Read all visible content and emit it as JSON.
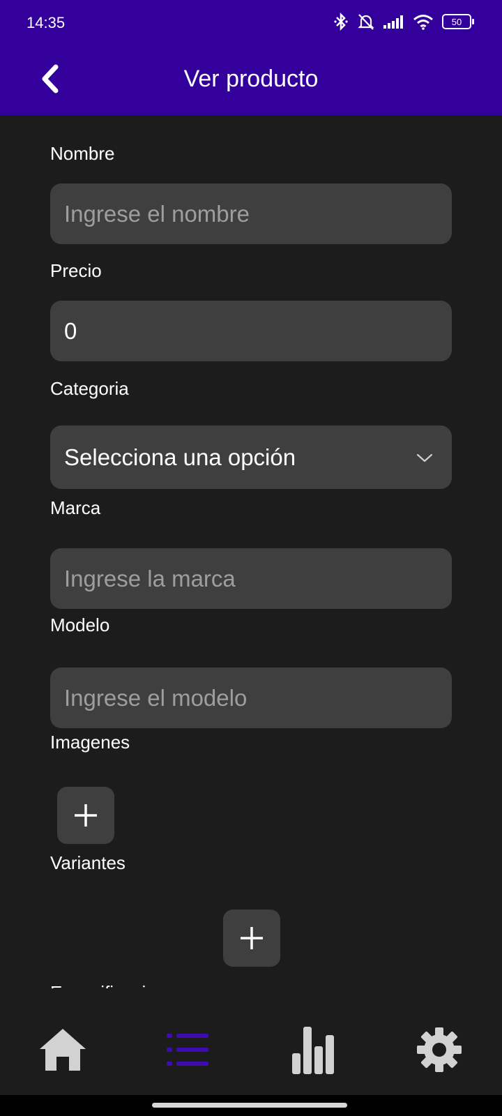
{
  "status_bar": {
    "time": "14:35",
    "battery": "50",
    "icons": [
      "bluetooth-icon",
      "bell-off-icon",
      "signal-icon",
      "wifi-icon",
      "battery-icon"
    ]
  },
  "header": {
    "title": "Ver producto",
    "back_icon": "chevron-left-icon"
  },
  "form": {
    "nombre": {
      "label": "Nombre",
      "placeholder": "Ingrese el nombre",
      "value": ""
    },
    "precio": {
      "label": "Precio",
      "value": "0"
    },
    "categoria": {
      "label": "Categoria",
      "selected": "Selecciona una opción"
    },
    "marca": {
      "label": "Marca",
      "placeholder": "Ingrese la marca",
      "value": ""
    },
    "modelo": {
      "label": "Modelo",
      "placeholder": "Ingrese el modelo",
      "value": ""
    },
    "imagenes": {
      "label": "Imagenes",
      "add_icon": "plus-icon"
    },
    "variantes": {
      "label": "Variantes",
      "add_icon": "plus-icon"
    },
    "especificaciones": {
      "label": "Especificaciones"
    }
  },
  "bottom_nav": {
    "items": [
      {
        "icon": "home-icon",
        "active": false
      },
      {
        "icon": "list-icon",
        "active": true
      },
      {
        "icon": "bar-chart-icon",
        "active": false
      },
      {
        "icon": "gear-icon",
        "active": false
      }
    ]
  },
  "colors": {
    "accent": "#34009c",
    "active_nav": "#3d0cb0",
    "background": "#1c1c1c",
    "input_bg": "#3f3f3f",
    "icon_inactive": "#d2d2d2"
  }
}
